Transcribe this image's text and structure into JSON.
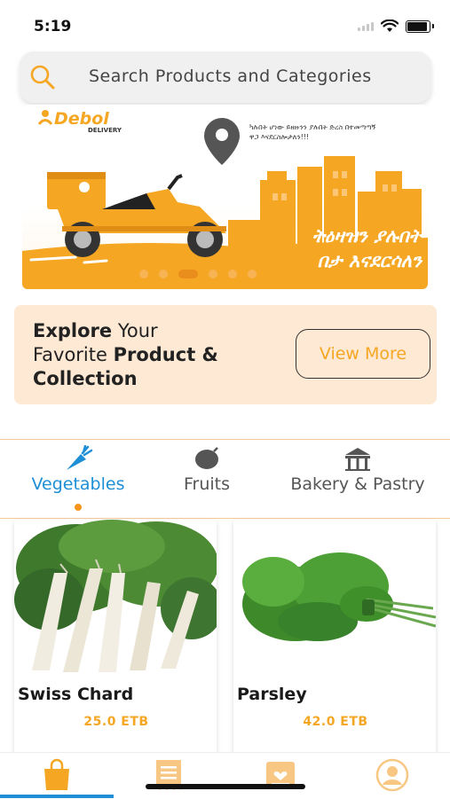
{
  "status": {
    "time": "5:19"
  },
  "search": {
    "placeholder": "Search Products and Categories"
  },
  "banner": {
    "brand": "Debol",
    "brand_sub": "DELIVERY",
    "amharic_small": "ካሉበት ሆነው ይዘዙንን ያሉበት ድረስ በተመጣጣኝ ዋጋ እናደርስሎታለን!!!",
    "amharic_big_line1": "ትዕዛዝን ያሉበት",
    "amharic_big_line2": "በታ እናደርሳለን",
    "slides": 6,
    "active_slide": 3
  },
  "explore": {
    "line1_bold": "Explore",
    "line1_rest": " Your",
    "line2_normal": "Favorite ",
    "line2_bold": "Product &",
    "line3_bold": "Collection",
    "button": "View More"
  },
  "categories": [
    {
      "label": "Vegetables",
      "icon": "carrot-icon",
      "active": true
    },
    {
      "label": "Fruits",
      "icon": "fruit-icon",
      "active": false
    },
    {
      "label": "Bakery & Pastry",
      "icon": "bakery-icon",
      "active": false
    }
  ],
  "products": [
    {
      "name": "Swiss Chard",
      "price": "25.0 ETB"
    },
    {
      "name": "Parsley",
      "price": "42.0 ETB"
    }
  ],
  "tabbar": {
    "items": [
      "shopping-bag-icon",
      "receipt-icon",
      "favorites-icon",
      "profile-icon"
    ],
    "active": 0
  },
  "colors": {
    "accent": "#f5a623",
    "active_blue": "#1e8fd6",
    "explore_bg": "#fde9d4"
  }
}
